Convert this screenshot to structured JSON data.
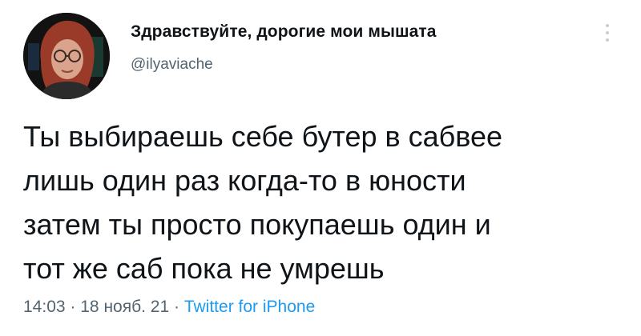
{
  "author": {
    "display_name": "Здравствуйте, дорогие мои мышата",
    "handle": "@ilyaviache"
  },
  "tweet": {
    "lines": [
      "Ты выбираешь себе бутер в сабвее",
      "лишь один раз когда-то в юности",
      "затем ты просто покупаешь один и",
      "тот же саб пока не умрешь"
    ],
    "time": "14:03",
    "separator": "·",
    "date": "18 нояб. 21",
    "source": "Twitter for iPhone"
  },
  "icons": {
    "more": "vertical-ellipsis-icon",
    "avatar": "profile-photo"
  },
  "colors": {
    "text": "#0f1419",
    "secondary": "#536471",
    "link": "#1d9bf0"
  }
}
